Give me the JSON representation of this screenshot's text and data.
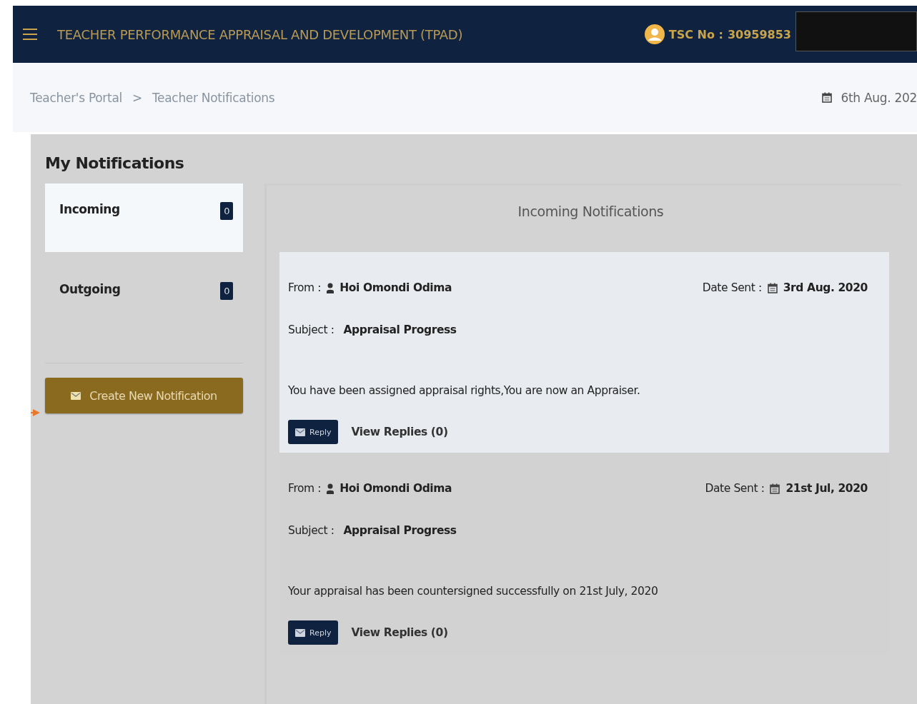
{
  "header": {
    "title": "TEACHER PERFORMANCE APPRAISAL AND DEVELOPMENT (TPAD)",
    "tsc_label": "TSC No :",
    "tsc_value": "30959853"
  },
  "breadcrumb": {
    "items": [
      "Teacher's Portal",
      "Teacher Notifications"
    ],
    "separator": ">",
    "date": "6th Aug. 202"
  },
  "panel": {
    "title": "My Notifications",
    "tabs": [
      {
        "label": "Incoming",
        "count": "0",
        "selected": true
      },
      {
        "label": "Outgoing",
        "count": "0",
        "selected": false
      }
    ],
    "create_button": "Create New Notification",
    "list_title": "Incoming Notifications",
    "notifications": [
      {
        "from_label": "From :",
        "from": "Hoi Omondi Odima",
        "date_label": "Date Sent :",
        "date": "3rd Aug. 2020",
        "subject_label": "Subject :",
        "subject": "Appraisal Progress",
        "message": "You have been assigned appraisal rights,You are now an Appraiser.",
        "reply": "Reply",
        "view_replies": "View Replies (0)",
        "highlighted": true
      },
      {
        "from_label": "From :",
        "from": "Hoi Omondi Odima",
        "date_label": "Date Sent :",
        "date": "21st Jul, 2020",
        "subject_label": "Subject :",
        "subject": "Appraisal Progress",
        "message": "Your appraisal has been countersigned successfully on 21st July, 2020",
        "reply": "Reply",
        "view_replies": "View Replies (0)",
        "highlighted": false
      }
    ]
  }
}
